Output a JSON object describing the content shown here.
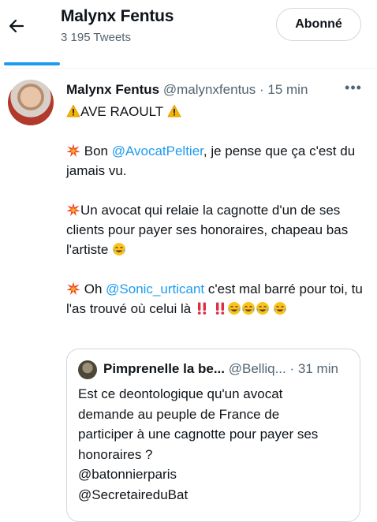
{
  "header": {
    "name": "Malynx Fentus",
    "tweet_count": "3 195 Tweets",
    "follow_label": "Abonné"
  },
  "tweet": {
    "author_name": "Malynx Fentus",
    "handle": "@malynxfentus",
    "time_sep": "·",
    "time": "15 min",
    "more_label": "•••",
    "line1_text": "AVE RAOULT",
    "p2_pre": "Bon ",
    "p2_mention": "@AvocatPeltier",
    "p2_post": ", je pense que ça c'est du jamais vu.",
    "p3_text": "Un avocat qui relaie la cagnotte d'un de ses clients pour payer ses honoraires, chapeau bas l'artiste",
    "p4_pre": "Oh ",
    "p4_mention": "@Sonic_urticant",
    "p4_post": " c'est mal barré pour toi, tu l'as trouvé où celui là "
  },
  "quote": {
    "author_name": "Pimprenelle la be...",
    "handle": "@Belliq...",
    "time_sep": "·",
    "time": "31 min",
    "lines": [
      "Est ce deontologique qu'un avocat",
      "demande au peuple de France de",
      "participer à une cagnotte pour payer ses",
      "honoraires ?",
      "@batonnierparis",
      "@SecretaireduBat"
    ]
  },
  "icons": {
    "back": "arrow-left-icon",
    "warning": "warning-icon",
    "collision": "collision-icon",
    "joy": "tears-of-joy-icon",
    "exclamation": "double-exclamation-icon"
  },
  "colors": {
    "accent": "#1d9bf0",
    "text": "#0f1419",
    "secondary": "#536471",
    "border": "#cfd9de"
  }
}
